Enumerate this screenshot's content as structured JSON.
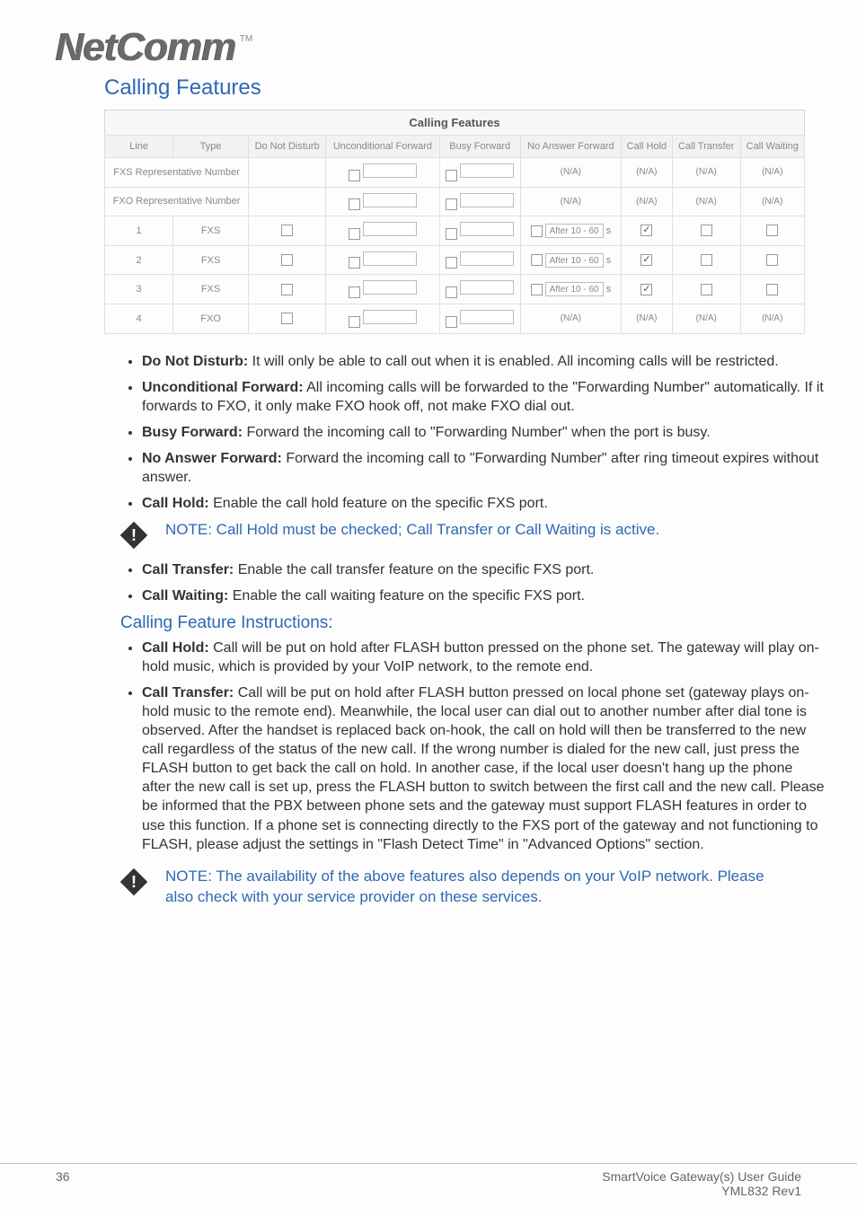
{
  "brand": {
    "name": "NetComm",
    "tm": "TM"
  },
  "section_title": "Calling Features",
  "table": {
    "caption": "Calling Features",
    "headers": [
      "Line",
      "Type",
      "Do Not Disturb",
      "Unconditional Forward",
      "Busy Forward",
      "No Answer Forward",
      "Call Hold",
      "Call Transfer",
      "Call Waiting"
    ],
    "rows": [
      {
        "line": "FXS Representative Number",
        "colspan_first": 2,
        "dnd": "",
        "uncond": "☐",
        "busy": "☐",
        "noans": "(N/A)",
        "hold": "(N/A)",
        "xfer": "(N/A)",
        "wait": "(N/A)"
      },
      {
        "line": "FXO Representative Number",
        "colspan_first": 2,
        "dnd": "",
        "uncond": "☐",
        "busy": "☐",
        "noans": "(N/A)",
        "hold": "(N/A)",
        "xfer": "(N/A)",
        "wait": "(N/A)"
      },
      {
        "line": "1",
        "type": "FXS",
        "dnd": "☐",
        "uncond": "☐",
        "busy": "☐",
        "noans_chk": true,
        "noans": "After 10 - 60",
        "hold": "☑",
        "xfer": "☐",
        "wait": "☐"
      },
      {
        "line": "2",
        "type": "FXS",
        "dnd": "☐",
        "uncond": "☐",
        "busy": "☐",
        "noans_chk": true,
        "noans": "After 10 - 60",
        "hold": "☑",
        "xfer": "☐",
        "wait": "☐"
      },
      {
        "line": "3",
        "type": "FXS",
        "dnd": "☐",
        "uncond": "☐",
        "busy": "☐",
        "noans_chk": true,
        "noans": "After 10 - 60",
        "hold": "☑",
        "xfer": "☐",
        "wait": "☐"
      },
      {
        "line": "4",
        "type": "FXO",
        "dnd": "☐",
        "uncond": "☐",
        "busy": "☐",
        "noans": "(N/A)",
        "hold": "(N/A)",
        "xfer": "(N/A)",
        "wait": "(N/A)"
      }
    ]
  },
  "bullets1": [
    {
      "b": "Do Not Disturb:",
      "t": " It will only be able to call out when it is enabled. All incoming calls will be restricted."
    },
    {
      "b": "Unconditional Forward:",
      "t": " All incoming calls will be forwarded to the \"Forwarding Number\" automatically. If it forwards to FXO, it only make FXO hook off, not make FXO dial out."
    },
    {
      "b": "Busy Forward:",
      "t": " Forward the incoming call to \"Forwarding Number\" when the port is busy."
    },
    {
      "b": "No Answer Forward:",
      "t": " Forward the incoming call to \"Forwarding Number\" after ring timeout expires without answer."
    },
    {
      "b": "Call Hold:",
      "t": " Enable the call hold feature on the specific FXS port."
    }
  ],
  "note1": "NOTE: Call Hold must be checked; Call Transfer or Call Waiting is active.",
  "bullets2": [
    {
      "b": "Call Transfer:",
      "t": " Enable the call transfer feature on the specific FXS port."
    },
    {
      "b": "Call Waiting:",
      "t": " Enable the call waiting feature on the specific FXS port."
    }
  ],
  "instructions_title": "Calling Feature Instructions:",
  "bullets3": [
    {
      "b": "Call Hold:",
      "t": " Call will be put on hold after FLASH button pressed on the phone set. The gateway will play on-hold music, which is provided by your VoIP network, to the remote end."
    },
    {
      "b": "Call Transfer:",
      "t": " Call will be put on hold after FLASH button pressed on local phone set (gateway plays on-hold music to the remote end). Meanwhile, the local user can dial out to another number after dial tone is observed. After the handset is replaced back on-hook, the call on hold will then be transferred to the new call regardless of the status of the new call. If the wrong number is dialed for the new call, just press the FLASH button to get back the call on hold. In another case, if the local user doesn't hang up the phone after the new call is set up, press the FLASH button to switch between the first call and the new call. Please be informed that the PBX between phone sets and the gateway must support FLASH features in order to use this function. If a phone set is connecting directly to the FXS port of the gateway and not functioning to FLASH, please adjust the settings in \"Flash Detect Time\" in \"Advanced Options\" section."
    }
  ],
  "note2": "NOTE: The availability of the above features also depends on your VoIP network. Please also check with your service provider on these services.",
  "footer": {
    "page": "36",
    "guide": "SmartVoice Gateway(s) User Guide",
    "rev": "YML832 Rev1"
  }
}
